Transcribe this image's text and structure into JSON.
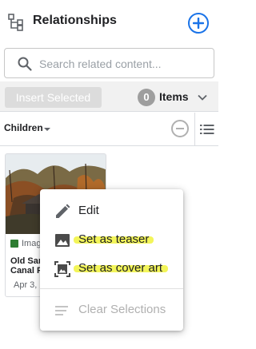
{
  "header": {
    "title": "Relationships"
  },
  "search": {
    "placeholder": "Search related content..."
  },
  "toolbar": {
    "insert_label": "Insert Selected",
    "item_count": "0",
    "items_label": "Items"
  },
  "filter": {
    "relation": "Children"
  },
  "card": {
    "media_type": "Image",
    "title": "Old Sandy Creek Canal Park",
    "date": "Apr 3, 2024"
  },
  "menu": {
    "items": [
      {
        "label": "Edit",
        "icon": "pencil-icon",
        "enabled": true
      },
      {
        "label": "Set as teaser",
        "icon": "image-icon",
        "enabled": true
      },
      {
        "label": "Set as cover art",
        "icon": "cover-art-icon",
        "enabled": true
      },
      {
        "label": "Clear Selections",
        "icon": "clear-lines-icon",
        "enabled": false
      }
    ]
  },
  "colors": {
    "accent": "#1a73e8",
    "highlight": "#f3f55a",
    "disabled": "#b0b0b0"
  }
}
